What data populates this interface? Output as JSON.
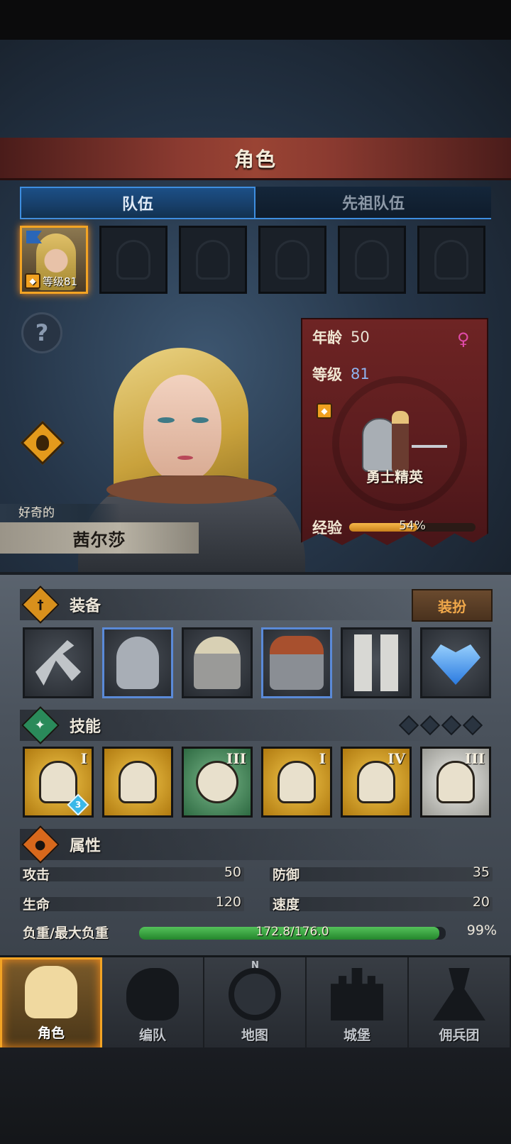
{
  "header": {
    "title": "角色"
  },
  "tabs": {
    "team": "队伍",
    "ancestor": "先祖队伍"
  },
  "team_slot": {
    "level_text": "等级81"
  },
  "character": {
    "trait": "好奇的",
    "name": "茜尔莎",
    "age_label": "年龄",
    "age": "50",
    "gender_symbol": "♀",
    "level_label": "等级",
    "level": "81",
    "class_name": "勇士精英",
    "exp_label": "经验",
    "exp_percent_text": "54%",
    "exp_progress": 0.54
  },
  "equipment": {
    "title": "装备",
    "dress_button": "装扮",
    "items": [
      "hammer-icon",
      "shield-icon",
      "helmet-icon",
      "armor-icon",
      "boots-icon",
      "amulet-icon"
    ]
  },
  "skills": {
    "title": "技能",
    "items": [
      {
        "icon": "shield-sword-skill-icon",
        "rank": "I",
        "badge": "3"
      },
      {
        "icon": "shield-strike-skill-icon",
        "rank": ""
      },
      {
        "icon": "target-skill-icon",
        "rank": "III"
      },
      {
        "icon": "shield-bash-skill-icon",
        "rank": "I"
      },
      {
        "icon": "shield-break-skill-icon",
        "rank": "IV"
      },
      {
        "icon": "heal-shield-skill-icon",
        "rank": "III"
      }
    ]
  },
  "attributes": {
    "title": "属性",
    "attack_label": "攻击",
    "attack": "50",
    "defense_label": "防御",
    "defense": "35",
    "hp_label": "生命",
    "hp": "120",
    "speed_label": "速度",
    "speed": "20",
    "load_label": "负重/最大负重",
    "load_text": "172.8/176.0",
    "load_progress": 0.98,
    "load_percent": "99%"
  },
  "nav": {
    "character": "角色",
    "team": "编队",
    "map": "地图",
    "map_compass": "N",
    "castle": "城堡",
    "mercenary": "佣兵团"
  },
  "colors": {
    "accent": "#f3a424",
    "header_red": "#8a3a30",
    "tab_blue": "#3e8ee0",
    "level_blue": "#8fb4f0",
    "load_green": "#3aa842",
    "xp_orange": "#e39a2a"
  }
}
